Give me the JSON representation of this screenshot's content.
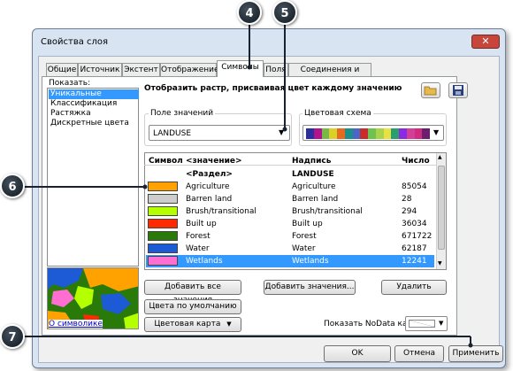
{
  "window": {
    "title": "Свойства слоя",
    "close_symbol": "✕"
  },
  "tabs": [
    "Общие",
    "Источник",
    "Экстент",
    "Отображение",
    "Символы",
    "Поля",
    "Соединения и Связи"
  ],
  "active_tab": "Символы",
  "show": {
    "label": "Показать:",
    "items": [
      "Уникальные значения",
      "Классификация",
      "Растяжка",
      "Дискретные цвета"
    ],
    "selected": "Уникальные значения",
    "link": "О символике"
  },
  "heading": "Отобразить растр, присваивая цвет каждому значению",
  "value_field": {
    "label": "Поле значений",
    "value": "LANDUSE"
  },
  "color_scheme": {
    "label": "Цветовая схема",
    "colors": [
      "#2b2f9e",
      "#b0138c",
      "#7ab648",
      "#d9d12a",
      "#e36a1e",
      "#1d8f8a",
      "#4a67c8",
      "#c92c2c",
      "#6fc24f",
      "#a9d44a",
      "#e6e245",
      "#2a9e6b",
      "#8a2be2",
      "#d0409a",
      "#cf2b7f",
      "#6b1d6e"
    ]
  },
  "table": {
    "headers": {
      "symbol": "Символ",
      "value": "<значение>",
      "label": "Надпись",
      "count": "Число"
    },
    "heading_row": {
      "value": "<Раздел>",
      "label": "LANDUSE"
    },
    "rows": [
      {
        "color": "#ffa200",
        "value": "Agriculture",
        "label": "Agriculture",
        "count": "85054"
      },
      {
        "color": "#cdcdcd",
        "value": "Barren land",
        "label": "Barren land",
        "count": "28"
      },
      {
        "color": "#b4ff00",
        "value": "Brush/transitional",
        "label": "Brush/transitional",
        "count": "294"
      },
      {
        "color": "#ff2a00",
        "value": "Built up",
        "label": "Built up",
        "count": "36034"
      },
      {
        "color": "#2a7a0a",
        "value": "Forest",
        "label": "Forest",
        "count": "671722"
      },
      {
        "color": "#1c5ad6",
        "value": "Water",
        "label": "Water",
        "count": "62187"
      },
      {
        "color": "#ff6ed0",
        "value": "Wetlands",
        "label": "Wetlands",
        "count": "12241"
      }
    ],
    "selected_value": "Wetlands"
  },
  "buttons": {
    "add_all": "Добавить все значения",
    "add_values": "Добавить значения...",
    "delete": "Удалить",
    "default_colors": "Цвета по умолчанию",
    "colormap": "Цветовая карта",
    "ok": "OK",
    "cancel": "Отмена",
    "apply": "Применить"
  },
  "nodata_label": "Показать NoData как",
  "icons": {
    "open": "folder-icon",
    "save": "save-icon"
  },
  "callouts": [
    "4",
    "5",
    "6",
    "7"
  ]
}
